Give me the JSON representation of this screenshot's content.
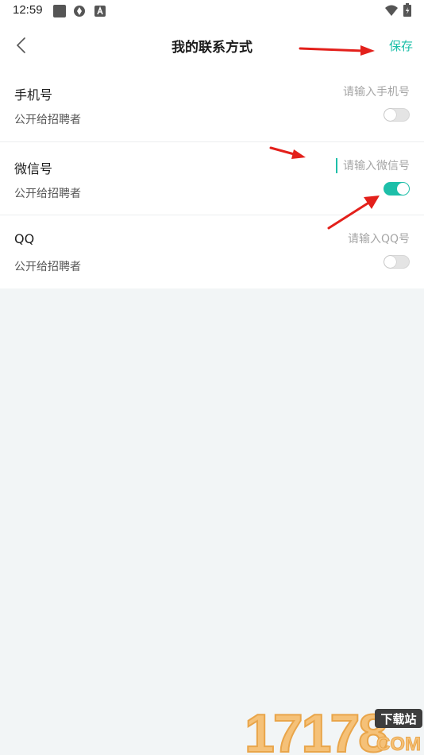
{
  "status_bar": {
    "time": "12:59"
  },
  "header": {
    "title": "我的联系方式",
    "save_label": "保存"
  },
  "rows": [
    {
      "label": "手机号",
      "placeholder": "请输入手机号",
      "sub_label": "公开给招聘者",
      "public": false
    },
    {
      "label": "微信号",
      "placeholder": "请输入微信号",
      "sub_label": "公开给招聘者",
      "public": true
    },
    {
      "label": "QQ",
      "placeholder": "请输入QQ号",
      "sub_label": "公开给招聘者",
      "public": false
    }
  ],
  "watermark": {
    "number": "17178",
    "badge": "下载站",
    "domain": "COM"
  },
  "colors": {
    "accent": "#1dbfa9",
    "arrow": "#e3201b",
    "background": "#f2f5f6"
  },
  "icons": [
    "back-arrow-icon",
    "square-icon",
    "aperture-icon",
    "a-badge-icon",
    "wifi-icon",
    "battery-icon"
  ]
}
